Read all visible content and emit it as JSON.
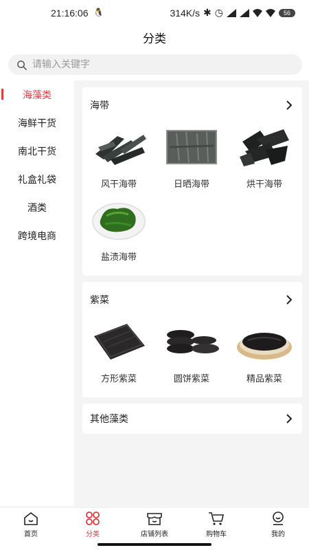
{
  "status_bar": {
    "time": "21:16:06",
    "speed": "314K/s",
    "battery": "56"
  },
  "page_title": "分类",
  "search": {
    "placeholder": "请输入关键字"
  },
  "sidebar": {
    "items": [
      {
        "label": "海藻类",
        "active": true
      },
      {
        "label": "海鲜干货"
      },
      {
        "label": "南北干货"
      },
      {
        "label": "礼盒礼袋"
      },
      {
        "label": "酒类"
      },
      {
        "label": "跨境电商"
      }
    ]
  },
  "sections": [
    {
      "title": "海带",
      "products": [
        {
          "name": "风干海带",
          "icon": "dried-kelp-strips-image"
        },
        {
          "name": "日晒海带",
          "icon": "sun-dried-kelp-sheet-image"
        },
        {
          "name": "烘干海带",
          "icon": "baked-kelp-pieces-image"
        },
        {
          "name": "盐渍海带",
          "icon": "salted-kelp-bowl-image"
        }
      ]
    },
    {
      "title": "紫菜",
      "products": [
        {
          "name": "方形紫菜",
          "icon": "square-laver-image"
        },
        {
          "name": "圆饼紫菜",
          "icon": "round-laver-cakes-image"
        },
        {
          "name": "精品紫菜",
          "icon": "premium-laver-plate-image"
        }
      ]
    },
    {
      "title": "其他藻类",
      "products": []
    }
  ],
  "bottom_nav": {
    "items": [
      {
        "label": "首页",
        "icon": "home-icon"
      },
      {
        "label": "分类",
        "icon": "category-icon",
        "active": true
      },
      {
        "label": "店铺列表",
        "icon": "store-icon"
      },
      {
        "label": "购物车",
        "icon": "cart-icon"
      },
      {
        "label": "我的",
        "icon": "profile-icon"
      }
    ]
  },
  "colors": {
    "accent": "#e0383e",
    "background": "#f4f4f4"
  }
}
